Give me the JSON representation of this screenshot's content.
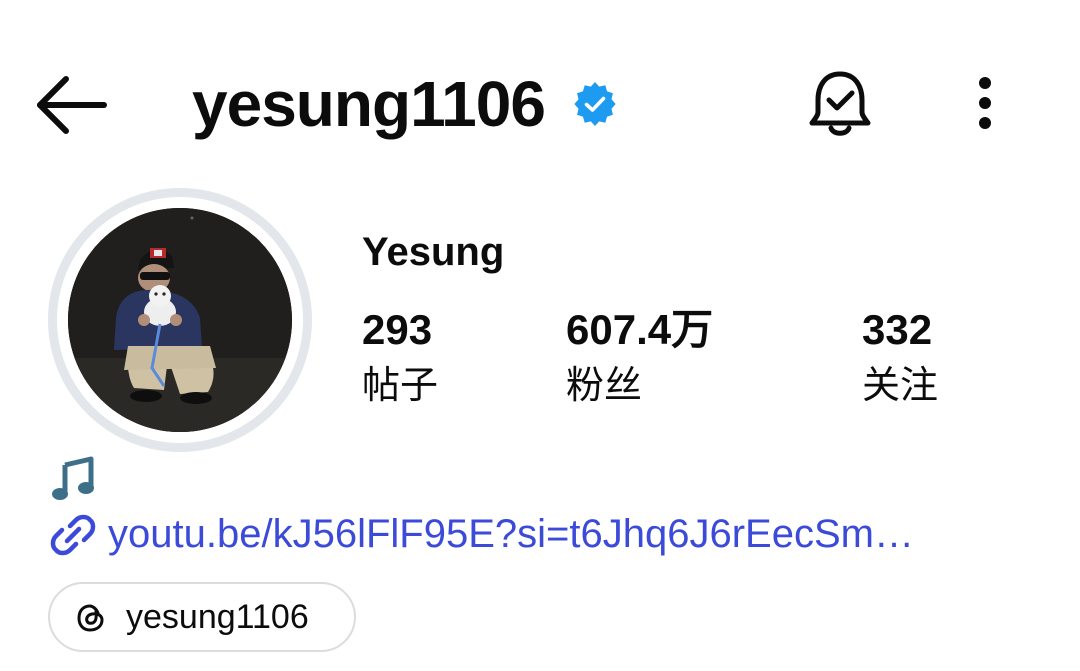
{
  "header": {
    "title": "yesung1106",
    "verified": true,
    "verified_color": "#1d9bf0",
    "back_icon": "back-arrow-icon",
    "bell_icon": "bell-check-icon",
    "more_icon": "more-vertical-icon"
  },
  "profile": {
    "display_name": "Yesung",
    "stats": [
      {
        "value": "293",
        "label": "帖子"
      },
      {
        "value": "607.4万",
        "label": "粉丝"
      },
      {
        "value": "332",
        "label": "关注"
      }
    ],
    "bio_icon": "music-note-icon",
    "link": {
      "icon": "link-icon",
      "text": "youtu.be/kJ56lFlF95E?si=t6Jhq6J6rEecSm…",
      "color": "#3b4ad9"
    },
    "threads": {
      "icon": "threads-icon",
      "label": "yesung1106"
    }
  }
}
